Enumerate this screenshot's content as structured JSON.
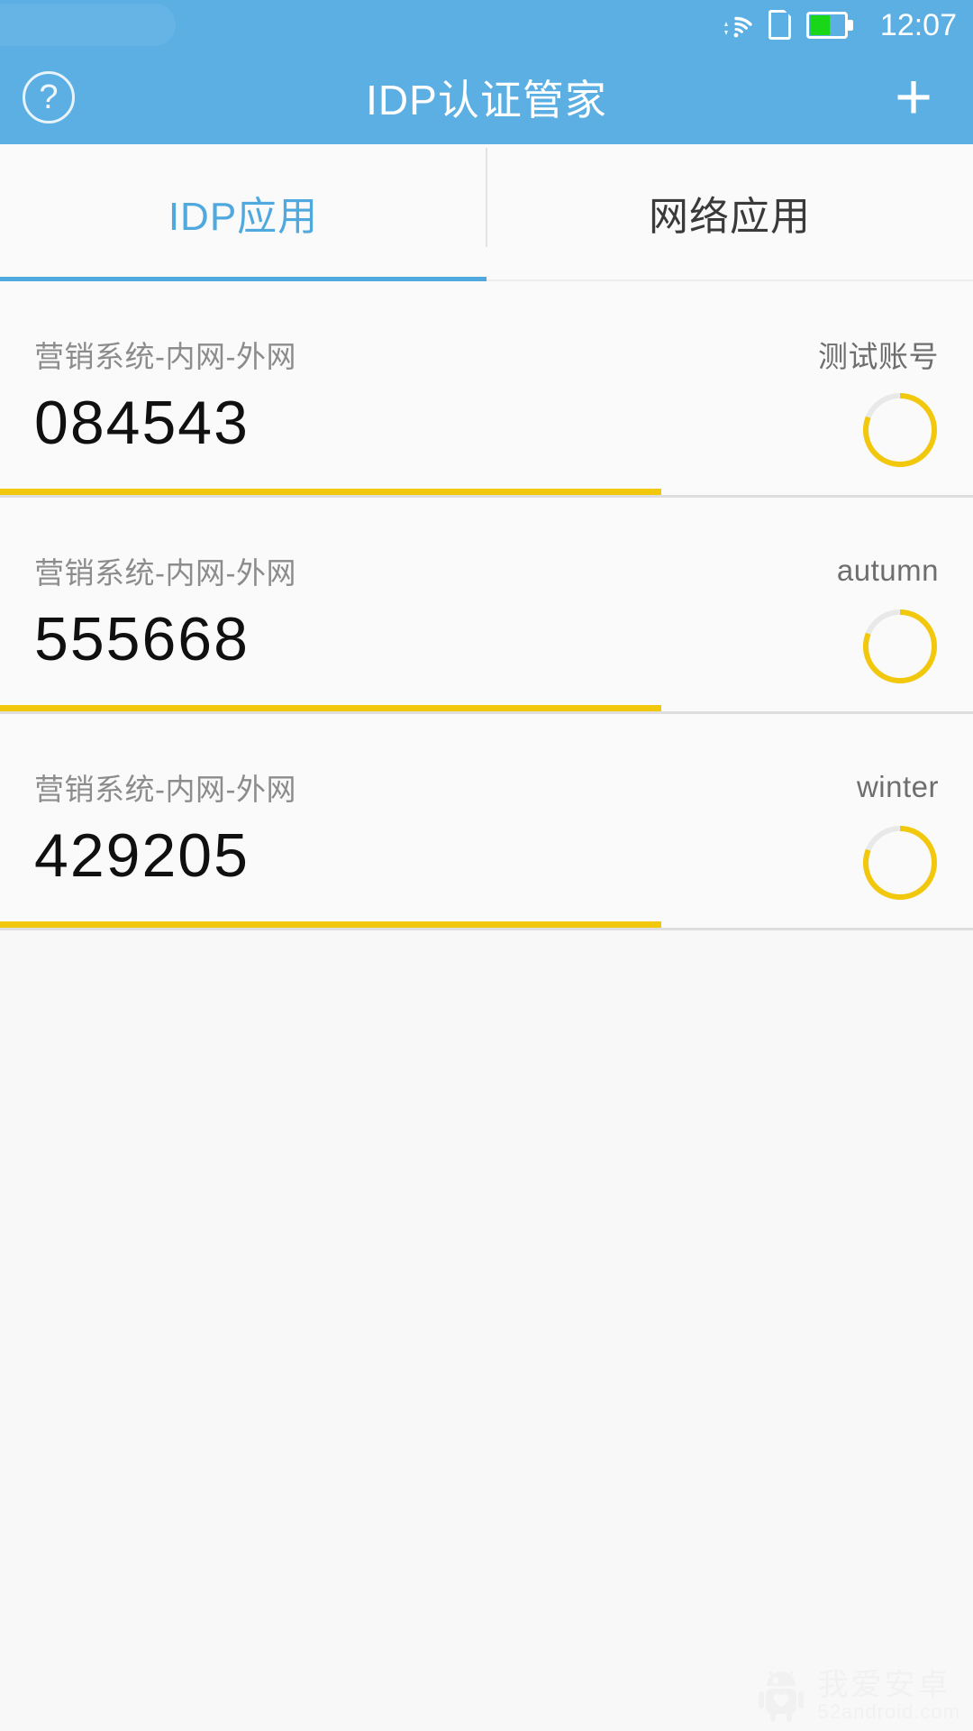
{
  "statusbar": {
    "time": "12:07",
    "icons": [
      "wifi-icon",
      "sim-card-icon",
      "battery-icon"
    ],
    "battery_level_pct": 58,
    "battery_fill_color": "#19D619",
    "background_color": "#5BAFE3"
  },
  "header": {
    "title": "IDP认证管家",
    "help_icon_glyph": "?",
    "add_icon_glyph": "+",
    "background_color": "#5BAFE3",
    "title_color": "#FFFFFF"
  },
  "tabs": {
    "active_index": 0,
    "indicator_color": "#4FA8DE",
    "items": [
      {
        "label": "IDP应用",
        "active": true
      },
      {
        "label": "网络应用",
        "active": false
      }
    ]
  },
  "list": {
    "accent_color": "#F2C80C",
    "items": [
      {
        "label": "营销系统-内网-外网",
        "account": "测试账号",
        "code": "084543",
        "progress_pct": 81,
        "divider_pct": 68
      },
      {
        "label": "营销系统-内网-外网",
        "account": "autumn",
        "code": "555668",
        "progress_pct": 81,
        "divider_pct": 68
      },
      {
        "label": "营销系统-内网-外网",
        "account": "winter",
        "code": "429205",
        "progress_pct": 81,
        "divider_pct": 68
      }
    ]
  },
  "watermark": {
    "cn_text": "我爱安卓",
    "url_text": "52android.com"
  }
}
